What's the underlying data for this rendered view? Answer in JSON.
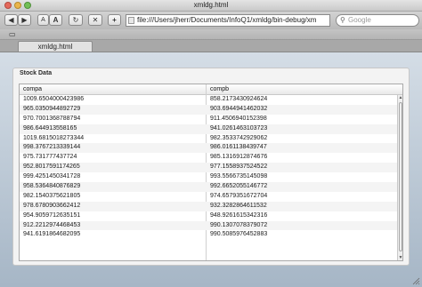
{
  "window": {
    "title": "xmldg.html"
  },
  "toolbar": {
    "back_icon": "left-arrow",
    "forward_icon": "right-arrow",
    "text_smaller_label": "A",
    "text_larger_label": "A",
    "reload_icon": "reload-icon",
    "stop_icon": "stop-icon",
    "add_label": "+",
    "url": "file:///Users/jherr/Documents/InfoQ1/xmldg/bin-debug/xm",
    "search_placeholder": "Google"
  },
  "tab": {
    "label": "xmldg.html"
  },
  "panel": {
    "title": "Stock Data"
  },
  "grid": {
    "columns": [
      "compa",
      "compb"
    ],
    "rows": [
      [
        "1009.6504000423986",
        "858.2173430924624"
      ],
      [
        "965.0350944892729",
        "903.6944941462032"
      ],
      [
        "970.7001368788794",
        "911.4506940152398"
      ],
      [
        "986.644913558165",
        "941.0261463103723"
      ],
      [
        "1019.6815018273344",
        "982.3533742929062"
      ],
      [
        "998.3767213339144",
        "986.0161138439747"
      ],
      [
        "975.731777437724",
        "985.1316912874676"
      ],
      [
        "952.8017591174265",
        "977.1558937524522"
      ],
      [
        "999.4251450341728",
        "993.5566735145098"
      ],
      [
        "958.5364840876829",
        "992.6652055146772"
      ],
      [
        "982.1540375621805",
        "974.6579351672704"
      ],
      [
        "978.6780903662412",
        "932.3282864611532"
      ],
      [
        "954.9059712635151",
        "948.9261615342316"
      ],
      [
        "912.2212974468453",
        "990.1307078379072"
      ],
      [
        "941.6191864682095",
        "990.5085976452883"
      ]
    ]
  }
}
